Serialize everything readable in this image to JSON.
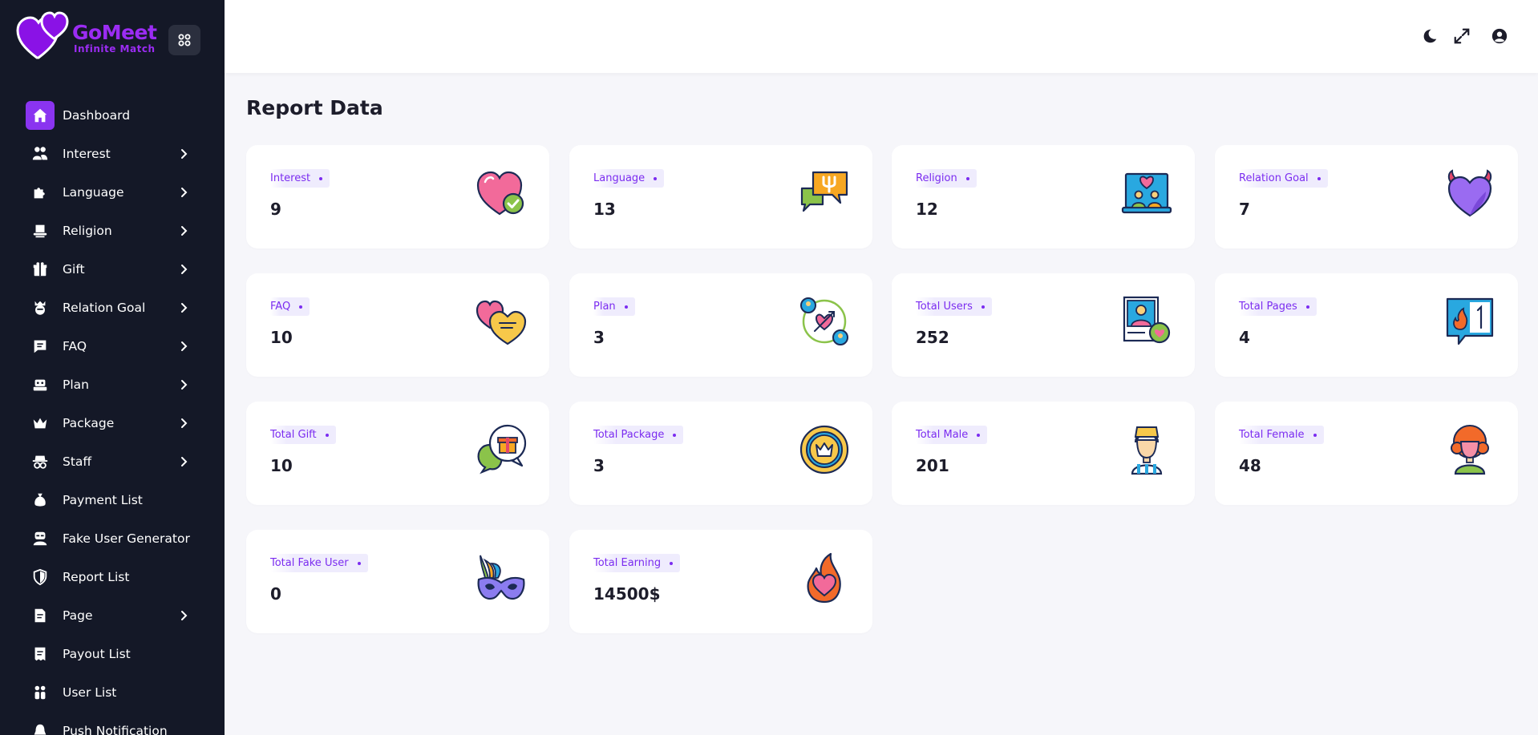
{
  "brand": {
    "name": "GoMeet",
    "tagline": "Infinite Match"
  },
  "page": {
    "title": "Report Data"
  },
  "colors": {
    "accent": "#8a34f0",
    "sidebar_bg": "#141827",
    "label_text": "#7b2cf0",
    "label_bg": "#efecfd"
  },
  "sidebar": {
    "items": [
      {
        "label": "Dashboard",
        "icon": "home-icon",
        "active": true,
        "has_submenu": false
      },
      {
        "label": "Interest",
        "icon": "people-icon",
        "has_submenu": true
      },
      {
        "label": "Language",
        "icon": "puzzle-icon",
        "has_submenu": true
      },
      {
        "label": "Religion",
        "icon": "hat-icon",
        "has_submenu": true
      },
      {
        "label": "Gift",
        "icon": "gift-icon",
        "has_submenu": true
      },
      {
        "label": "Relation Goal",
        "icon": "crown-face-icon",
        "has_submenu": true
      },
      {
        "label": "FAQ",
        "icon": "message-icon",
        "has_submenu": true
      },
      {
        "label": "Plan",
        "icon": "robot-icon",
        "has_submenu": true
      },
      {
        "label": "Package",
        "icon": "crown-icon",
        "has_submenu": true
      },
      {
        "label": "Staff",
        "icon": "spy-icon",
        "has_submenu": true
      },
      {
        "label": "Payment List",
        "icon": "money-bag-icon",
        "has_submenu": false
      },
      {
        "label": "Fake User Generator",
        "icon": "mask-user-icon",
        "has_submenu": false
      },
      {
        "label": "Report List",
        "icon": "shield-icon",
        "has_submenu": false
      },
      {
        "label": "Page",
        "icon": "document-icon",
        "has_submenu": true
      },
      {
        "label": "Payout List",
        "icon": "receipt-icon",
        "has_submenu": false
      },
      {
        "label": "User List",
        "icon": "users-icon",
        "has_submenu": false
      },
      {
        "label": "Push Notification",
        "icon": "bell-icon",
        "has_submenu": false
      }
    ]
  },
  "topbar": {
    "icons": [
      "moon-icon",
      "expand-icon",
      "user-circle-icon"
    ]
  },
  "cards": [
    {
      "label": "Interest",
      "value": "9",
      "icon": "heart-check-icon"
    },
    {
      "label": "Language",
      "value": "13",
      "icon": "speech-bubbles-icon"
    },
    {
      "label": "Religion",
      "value": "12",
      "icon": "laptop-couple-icon"
    },
    {
      "label": "Relation Goal",
      "value": "7",
      "icon": "devil-heart-icon"
    },
    {
      "label": "FAQ",
      "value": "10",
      "icon": "hearts-chat-icon"
    },
    {
      "label": "Plan",
      "value": "3",
      "icon": "match-arrow-icon"
    },
    {
      "label": "Total Users",
      "value": "252",
      "icon": "profile-heart-icon"
    },
    {
      "label": "Total Pages",
      "value": "4",
      "icon": "fire-notification-icon"
    },
    {
      "label": "Total Gift",
      "value": "10",
      "icon": "gift-chat-icon"
    },
    {
      "label": "Total Package",
      "value": "3",
      "icon": "crown-coin-icon"
    },
    {
      "label": "Total Male",
      "value": "201",
      "icon": "male-avatar-icon"
    },
    {
      "label": "Total Female",
      "value": "48",
      "icon": "female-avatar-icon"
    },
    {
      "label": "Total Fake User",
      "value": "0",
      "icon": "carnival-mask-icon"
    },
    {
      "label": "Total Earning",
      "value": "14500$",
      "icon": "fire-heart-icon"
    }
  ]
}
